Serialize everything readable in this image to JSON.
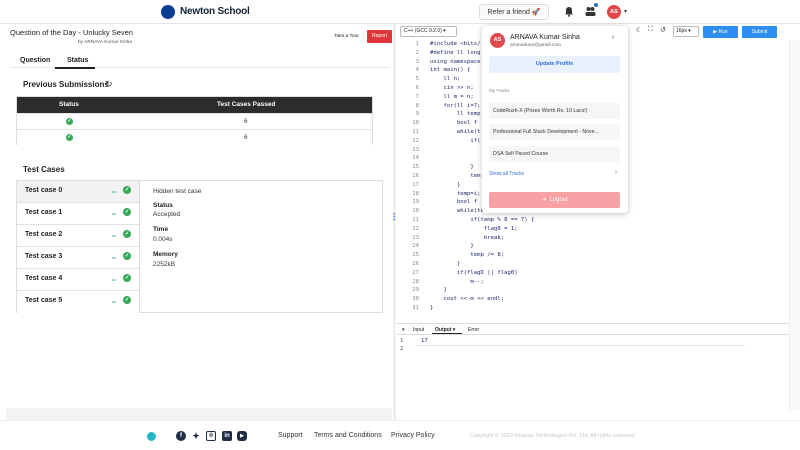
{
  "brand": {
    "name": "Newton School"
  },
  "topnav": {
    "refer_label": "Refer a friend 🚀",
    "avatar_initials": "AS",
    "caret": "▾"
  },
  "problem": {
    "title": "Question of the Day - Unlucky Seven",
    "author": "by ARNAVA Kumar Sinha"
  },
  "buttons": {
    "tour": "Take a Tour",
    "report": "Report"
  },
  "tabs": {
    "question": "Question",
    "status": "Status"
  },
  "previous_submissions": {
    "title": "Previous Submissions",
    "columns": [
      "Status",
      "Test Cases Passed"
    ],
    "rows": [
      {
        "status": "accepted",
        "passed": "6"
      },
      {
        "status": "accepted",
        "passed": "6"
      }
    ]
  },
  "test_cases": {
    "title": "Test Cases",
    "items": [
      {
        "name": "Test case 0",
        "ac": "ac"
      },
      {
        "name": "Test case 1",
        "ac": "ac"
      },
      {
        "name": "Test case 2",
        "ac": "ac"
      },
      {
        "name": "Test case 3",
        "ac": "ac"
      },
      {
        "name": "Test case 4",
        "ac": "ac"
      },
      {
        "name": "Test case 5",
        "ac": "ac"
      }
    ],
    "detail": {
      "hidden": "Hidden test case",
      "status_label": "Status",
      "status_value": "Accepted",
      "time_label": "Time",
      "time_value": "0.004s",
      "memory_label": "Memory",
      "memory_value": "2252kB"
    }
  },
  "editor": {
    "language": "C++ (GCC 9.2.0) ▾",
    "font_size": "16px ▾",
    "run": "▶ Run",
    "submit": "Submit",
    "lines": [
      {
        "n": "1",
        "code": "#include <bits/"
      },
      {
        "n": "2",
        "code": "#define ll long"
      },
      {
        "n": "3",
        "code": "using namespace"
      },
      {
        "n": "4",
        "code": "int main() {"
      },
      {
        "n": "5",
        "code": "    ll n;"
      },
      {
        "n": "6",
        "code": "    cin >> n;"
      },
      {
        "n": "7",
        "code": "    ll m = n;"
      },
      {
        "n": "8",
        "code": "    for(ll i=7;"
      },
      {
        "n": "9",
        "code": "        ll temp"
      },
      {
        "n": "10",
        "code": "        bool f"
      },
      {
        "n": "11",
        "code": "        while(t"
      },
      {
        "n": "12",
        "code": "            if("
      },
      {
        "n": "13",
        "code": ""
      },
      {
        "n": "14",
        "code": ""
      },
      {
        "n": "15",
        "code": "            }"
      },
      {
        "n": "16",
        "code": "            tem"
      },
      {
        "n": "17",
        "code": "        }"
      },
      {
        "n": "18",
        "code": "        temp=i;"
      },
      {
        "n": "19",
        "code": "        bool f"
      },
      {
        "n": "20",
        "code": "        while(temp){"
      },
      {
        "n": "21",
        "code": "            if(temp % 8 == 7) {"
      },
      {
        "n": "22",
        "code": "                flag0 = 1;"
      },
      {
        "n": "23",
        "code": "                break;"
      },
      {
        "n": "24",
        "code": "            }"
      },
      {
        "n": "25",
        "code": "            temp /= 8;"
      },
      {
        "n": "26",
        "code": "        }"
      },
      {
        "n": "27",
        "code": "        if(flagD || flag0)"
      },
      {
        "n": "28",
        "code": "            m--;"
      },
      {
        "n": "29",
        "code": "    }"
      },
      {
        "n": "30",
        "code": "    cout << m << endl;"
      },
      {
        "n": "31",
        "code": "}"
      }
    ]
  },
  "io": {
    "tabs": [
      "Input",
      "Output ▾",
      "Error"
    ],
    "output_lines": [
      "1",
      "2"
    ],
    "output_value": "17"
  },
  "menu": {
    "initials": "AS",
    "name": "ARNAVA Kumar Sinha",
    "email": "arnavahaor@gmail.com",
    "chevron": "›",
    "update_profile": "Update Profile",
    "tracks_label": "My Tracks",
    "tracks": [
      "CodeRush-X (Prizes Worth Rs. 10 Lacs!)",
      "Professional Full Stack Development - Nove...",
      "DSA Self Paced Course"
    ],
    "show_all": "Show all Tracks",
    "logout": "Logout"
  },
  "footer": {
    "links": [
      "Support",
      "Terms and Conditions",
      "Privacy Policy"
    ],
    "copyright": "Copyright © 2023 Incanus Technologies Pvt. Ltd. All rights reserved.",
    "social": [
      "facebook-icon",
      "twitter-icon",
      "instagram-icon",
      "linkedin-icon",
      "youtube-icon"
    ]
  },
  "colors": {
    "accent": "#2f8ff0",
    "report": "#e0353a",
    "success": "#34a853",
    "logout": "#f7a1a4"
  }
}
